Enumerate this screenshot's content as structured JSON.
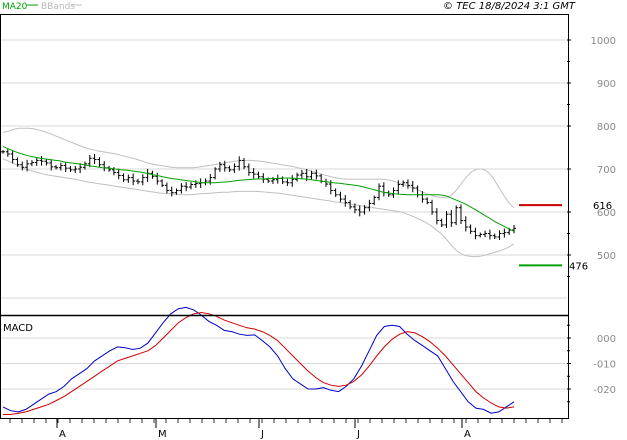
{
  "header": {
    "legend_ma": "MA20",
    "legend_bands": "BBands",
    "timestamp": "© TEC 18/8/2024 3:1 GMT"
  },
  "colors": {
    "ma": "#00a000",
    "bands": "#c0c0c0",
    "price": "#000000",
    "macd": "#0000cc",
    "signal": "#cc0000",
    "resistance": "#cc0000",
    "support": "#00a000",
    "grid": "#d8d8d8"
  },
  "chart_data": [
    {
      "type": "ohlc",
      "name": "price",
      "y_axis_ticks": [
        "1000",
        "900",
        "800",
        "700",
        "600",
        "500"
      ],
      "ylim": [
        390,
        1060
      ],
      "x_month_labels": [
        "A",
        "M",
        "J",
        "J",
        "A"
      ],
      "legend": [
        "MA20",
        "BBands"
      ],
      "levels": [
        {
          "label": "616",
          "value": 616,
          "kind": "resistance"
        },
        {
          "label": "476",
          "value": 476,
          "kind": "support"
        }
      ],
      "closes": [
        740,
        735,
        722,
        710,
        704,
        712,
        715,
        720,
        718,
        714,
        705,
        703,
        708,
        702,
        698,
        700,
        704,
        712,
        725,
        722,
        710,
        703,
        698,
        692,
        685,
        675,
        680,
        672,
        670,
        680,
        690,
        683,
        672,
        662,
        650,
        645,
        650,
        660,
        658,
        664,
        666,
        668,
        672,
        680,
        700,
        710,
        703,
        698,
        706,
        720,
        705,
        692,
        688,
        682,
        676,
        672,
        675,
        678,
        670,
        668,
        676,
        686,
        690,
        682,
        690,
        684,
        671,
        665,
        650,
        640,
        630,
        622,
        612,
        605,
        600,
        610,
        620,
        634,
        660,
        645,
        640,
        650,
        664,
        668,
        662,
        656,
        640,
        630,
        622,
        600,
        580,
        570,
        595,
        575,
        610,
        580,
        565,
        555,
        545,
        548,
        550,
        545,
        542,
        550,
        552,
        558,
        562
      ],
      "ma20": [
        752,
        746,
        740,
        735,
        731,
        728,
        725,
        723,
        721,
        719,
        716,
        714,
        712,
        710,
        707,
        705,
        703,
        702,
        700,
        698,
        697,
        695,
        693,
        690,
        687,
        684,
        681,
        678,
        676,
        674,
        672,
        670,
        668,
        668,
        668,
        669,
        670,
        672,
        674,
        675,
        676,
        677,
        677,
        678,
        678,
        679,
        679,
        678,
        677,
        676,
        674,
        672,
        670,
        668,
        667,
        665,
        663,
        661,
        658,
        654,
        650,
        646,
        644,
        642,
        641,
        640,
        640,
        640,
        640,
        640,
        640,
        638,
        632,
        626,
        620,
        612,
        604,
        595,
        586,
        577,
        570,
        562,
        555
      ],
      "bb_upper": [
        785,
        788,
        792,
        795,
        795,
        795,
        793,
        790,
        786,
        782,
        777,
        772,
        767,
        762,
        757,
        752,
        748,
        745,
        742,
        740,
        738,
        736,
        733,
        730,
        727,
        724,
        720,
        716,
        712,
        710,
        708,
        706,
        704,
        703,
        703,
        703,
        703,
        704,
        706,
        708,
        710,
        712,
        714,
        716,
        718,
        719,
        720,
        720,
        719,
        718,
        716,
        714,
        712,
        710,
        708,
        706,
        703,
        700,
        697,
        693,
        690,
        686,
        683,
        680,
        678,
        676,
        676,
        676,
        676,
        676,
        676,
        676,
        676,
        675,
        672,
        668,
        664,
        660,
        655,
        650,
        645,
        640,
        636,
        634,
        634,
        638,
        650,
        666,
        682,
        694,
        700,
        700,
        694,
        680,
        660,
        640,
        622,
        610
      ],
      "bb_lower": [
        724,
        718,
        712,
        706,
        700,
        696,
        692,
        689,
        686,
        684,
        682,
        680,
        678,
        676,
        673,
        670,
        668,
        666,
        664,
        662,
        660,
        658,
        656,
        654,
        652,
        650,
        648,
        646,
        644,
        643,
        642,
        641,
        640,
        640,
        641,
        642,
        643,
        644,
        645,
        646,
        646,
        647,
        648,
        648,
        648,
        648,
        647,
        646,
        645,
        644,
        642,
        640,
        638,
        636,
        634,
        632,
        630,
        628,
        626,
        624,
        622,
        620,
        618,
        616,
        614,
        612,
        610,
        608,
        606,
        604,
        602,
        600,
        595,
        590,
        584,
        578,
        570,
        560,
        550,
        536,
        520,
        508,
        500,
        497,
        496,
        497,
        500,
        504,
        508,
        512,
        518,
        526
      ]
    },
    {
      "type": "line",
      "name": "MACD",
      "title": "MACD",
      "y_axis_ticks": [
        "000",
        "-010",
        "-020"
      ],
      "ylim": [
        -32,
        8
      ],
      "series": [
        {
          "name": "macd",
          "values": [
            -27,
            -28.5,
            -29,
            -28,
            -26,
            -24,
            -22,
            -21,
            -19,
            -16,
            -14,
            -12,
            -9,
            -7,
            -5,
            -3.5,
            -3.8,
            -4.5,
            -4,
            -2,
            2,
            6,
            9.5,
            11.5,
            12,
            11,
            9,
            6.5,
            5,
            3,
            2.5,
            1.5,
            1,
            1.2,
            -1,
            -3.5,
            -7,
            -12,
            -16,
            -18,
            -20,
            -20,
            -19.5,
            -20.5,
            -21,
            -19,
            -16,
            -11,
            -5,
            1,
            4.5,
            5,
            4.5,
            1.5,
            -1,
            -3,
            -5,
            -7,
            -12,
            -17,
            -21,
            -25,
            -27.5,
            -28,
            -29.5,
            -29,
            -27,
            -25
          ]
        },
        {
          "name": "signal",
          "values": [
            -30,
            -30,
            -29.5,
            -29,
            -28,
            -27,
            -26,
            -24.5,
            -23,
            -21,
            -19,
            -17,
            -15,
            -13,
            -11,
            -9,
            -8,
            -7,
            -6,
            -5,
            -3,
            0,
            3,
            6,
            8,
            9.5,
            10,
            9.5,
            8.5,
            7,
            6,
            5,
            4,
            3.5,
            2.5,
            1,
            -1,
            -4,
            -7,
            -10,
            -13,
            -15.5,
            -17.5,
            -18.5,
            -19,
            -18.5,
            -17,
            -14.5,
            -11,
            -7,
            -3.5,
            -0.5,
            1.5,
            2.5,
            2,
            0.5,
            -1.5,
            -4,
            -7,
            -10.5,
            -14,
            -17.5,
            -21,
            -23.5,
            -25.5,
            -27,
            -27.5,
            -27
          ]
        }
      ]
    }
  ]
}
